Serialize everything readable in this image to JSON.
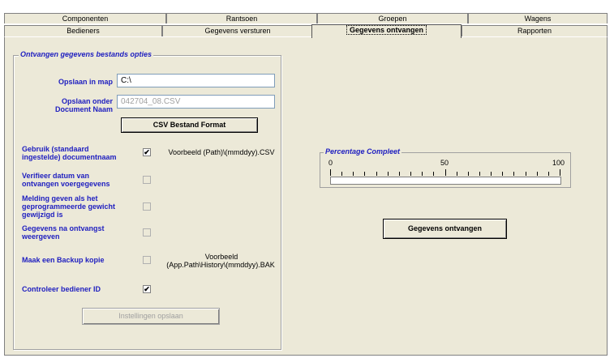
{
  "tabs_back": [
    "Componenten",
    "Rantsoen",
    "Groepen",
    "Wagens"
  ],
  "tabs_front": [
    "Bedieners",
    "Gegevens versturen",
    "Gegevens ontvangen",
    "Rapporten"
  ],
  "group_title": "Ontvangen gegevens bestands opties",
  "fields": {
    "map_label": "Opslaan in map",
    "map_value": "C:\\",
    "doc_label_1": "Opslaan onder",
    "doc_label_2": "Document Naam",
    "doc_value": "042704_08.CSV"
  },
  "csv_button": "CSV Bestand Format",
  "options": [
    {
      "label_lines": [
        "Gebruik (standaard",
        "ingestelde) documentnaam"
      ],
      "checked": true
    },
    {
      "label_lines": [
        "Verifieer datum van",
        "ontvangen voergegevens"
      ],
      "checked": false
    },
    {
      "label_lines": [
        "Melding geven als het",
        "geprogrammeerde gewicht",
        "gewijzigd is"
      ],
      "checked": false
    },
    {
      "label_lines": [
        "Gegevens na ontvangst",
        "weergeven"
      ],
      "checked": false
    },
    {
      "label_lines": [
        "Maak een Backup kopie"
      ],
      "checked": false
    },
    {
      "label_lines": [
        "Controleer bediener ID"
      ],
      "checked": true
    }
  ],
  "example_csv": "Voorbeeld   (Path)\\(mmddyy).CSV",
  "example_bak_1": "Voorbeeld",
  "example_bak_2": "(App.Path\\History\\(mmddyy).BAK",
  "save_button": "Instellingen opslaan",
  "progress": {
    "title": "Percentage Compleet",
    "scale": [
      "0",
      "50",
      "100"
    ],
    "value": 0
  },
  "receive_button": "Gegevens ontvangen",
  "check_glyph": "✔"
}
